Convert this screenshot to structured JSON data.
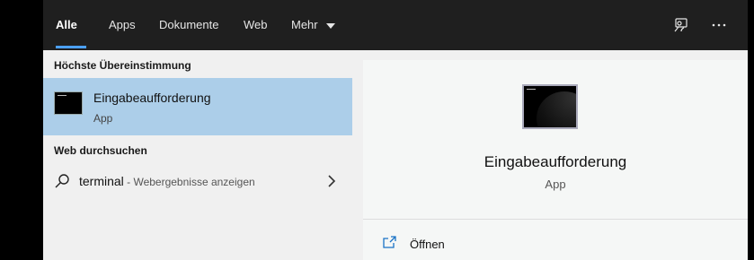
{
  "nav": {
    "tabs": [
      {
        "label": "Alle",
        "active": true
      },
      {
        "label": "Apps"
      },
      {
        "label": "Dokumente"
      },
      {
        "label": "Web"
      },
      {
        "label": "Mehr"
      }
    ],
    "feedback_icon": "feedback-icon",
    "more_icon": "more-options-icon"
  },
  "results": {
    "best_match_heading": "Höchste Übereinstimmung",
    "best_match": {
      "title": "Eingabeaufforderung",
      "subtitle": "App",
      "icon": "command-prompt-icon"
    },
    "web_heading": "Web durchsuchen",
    "web_item": {
      "query": "terminal",
      "hint": " - Webergebnisse anzeigen",
      "icon": "search-icon"
    }
  },
  "detail": {
    "title": "Eingabeaufforderung",
    "subtitle": "App",
    "actions": [
      {
        "label": "Öffnen",
        "icon": "open-icon"
      }
    ]
  },
  "colors": {
    "accent": "#4ba0ff",
    "selection": "#accee9",
    "topbar": "#1f1f1f"
  }
}
